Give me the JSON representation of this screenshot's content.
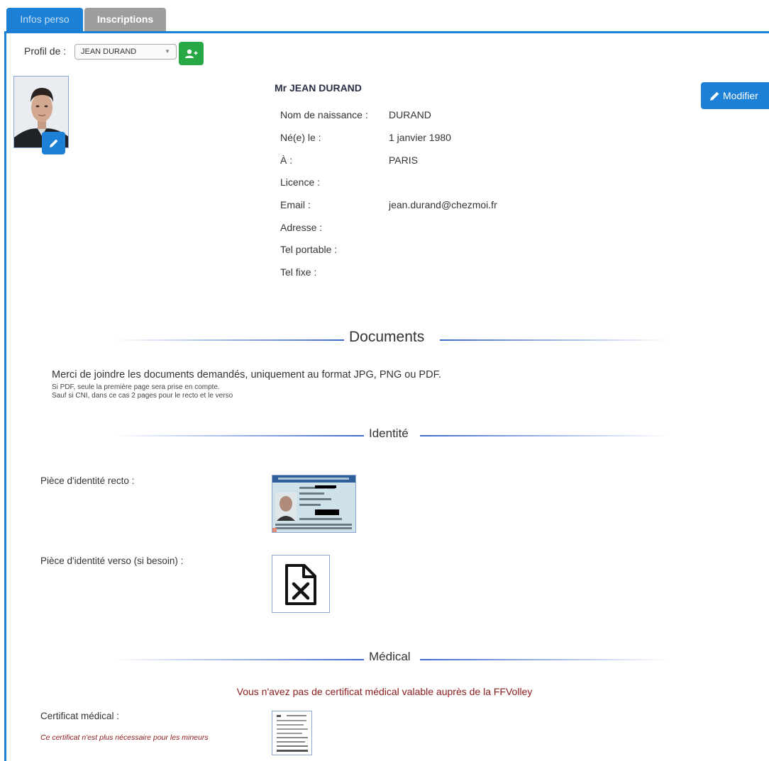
{
  "tabs": [
    {
      "label": "Infos perso"
    },
    {
      "label": "Inscriptions"
    }
  ],
  "profile_selector": {
    "label": "Profil de :",
    "selected": "JEAN DURAND"
  },
  "person": {
    "full_name": "Mr JEAN DURAND",
    "edit_label": "Modifier",
    "fields": [
      {
        "label": "Nom de naissance :",
        "value": "DURAND"
      },
      {
        "label": "Né(e) le :",
        "value": "1 janvier 1980"
      },
      {
        "label": "À :",
        "value": "PARIS"
      },
      {
        "label": "Licence :",
        "value": ""
      },
      {
        "label": "Email :",
        "value": "jean.durand@chezmoi.fr"
      },
      {
        "label": "Adresse :",
        "value": ""
      },
      {
        "label": "Tel portable :",
        "value": ""
      },
      {
        "label": "Tel fixe :",
        "value": ""
      }
    ]
  },
  "documents": {
    "title": "Documents",
    "instructions": "Merci de joindre les documents demandés, uniquement au format JPG, PNG ou PDF.",
    "note1": "Si PDF, seule la première page sera prise en compte.",
    "note2": "Sauf si CNI, dans ce cas 2 pages pour le recto et le verso"
  },
  "identity": {
    "title": "Identité",
    "recto_label": "Pièce d'identité recto :",
    "verso_label": "Pièce d'identité verso (si besoin) :"
  },
  "medical": {
    "title": "Médical",
    "warning": "Vous n'avez pas de certificat médical valable auprès de la FFVolley",
    "certificate_label": "Certificat médical :",
    "minor_note": "Ce certificat n'est plus nécessaire pour les mineurs"
  },
  "colors": {
    "primary": "#1b80d6",
    "success": "#28a745",
    "inactive_tab": "#9e9e9e",
    "warning_text": "#8b1a1a"
  }
}
